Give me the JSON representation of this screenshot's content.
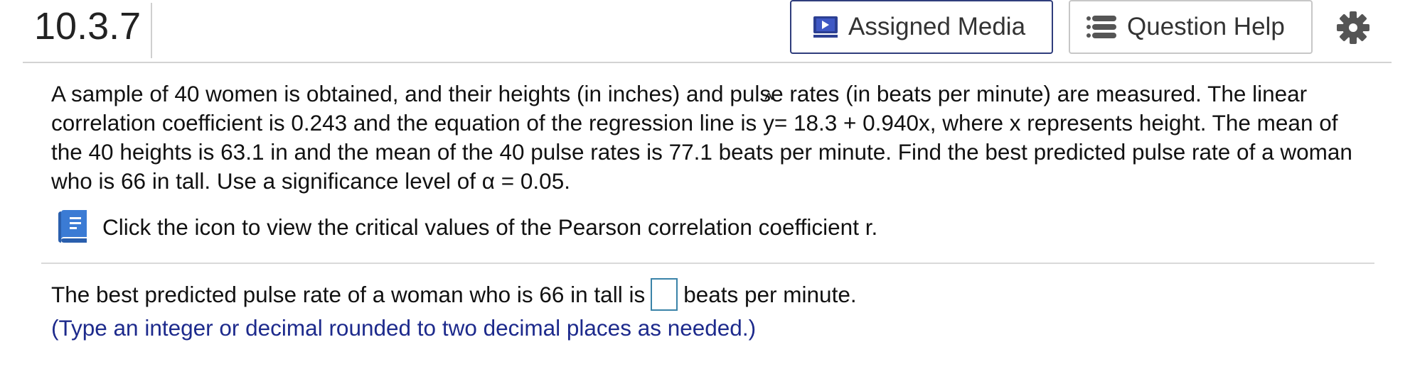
{
  "header": {
    "question_number": "10.3.7",
    "assigned_media_label": "Assigned Media",
    "question_help_label": "Question Help"
  },
  "problem": {
    "text_part1": "A sample of 40 women is obtained, and their heights (in inches) and pulse rates (in beats per minute) are measured. The linear correlation coefficient is 0.243 and the equation of the regression line is ",
    "y_symbol": "y",
    "text_part2": "= 18.3 + 0.940x, where x represents height. The mean of the 40 heights is 63.1 in and the mean of the 40 pulse rates is 77.1 beats per minute. Find the best predicted pulse rate of a woman who is 66 in tall. Use a significance level of α = 0.05."
  },
  "critical_values_link": "Click the icon to view the critical values of the Pearson correlation coefficient r.",
  "answer": {
    "prefix": "The best predicted pulse rate of a woman who is 66 in tall is",
    "value": "",
    "suffix": "beats per minute.",
    "hint": "(Type an integer or decimal rounded to two decimal places as needed.)"
  },
  "icons": {
    "media": "media-icon",
    "help": "list-icon",
    "settings": "gear-icon",
    "book": "book-icon"
  },
  "colors": {
    "hint_text": "#1d2a8c",
    "media_border": "#2f3d7c",
    "book_icon": "#3b7bd4",
    "input_border": "#3a83a8"
  }
}
